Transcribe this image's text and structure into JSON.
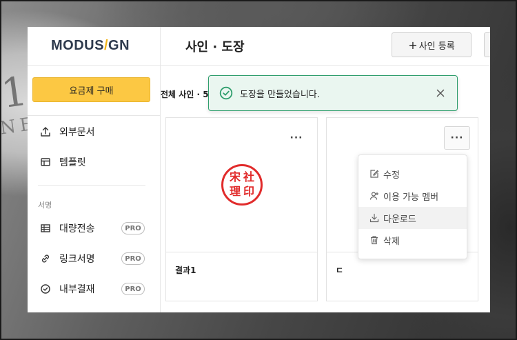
{
  "brand": {
    "logo_left": "MODUS",
    "logo_slash": "/",
    "logo_right": "GN"
  },
  "sidebar": {
    "plan_button": "요금제 구매",
    "items_top": [
      {
        "label": "외부문서",
        "icon": "upload-icon"
      },
      {
        "label": "템플릿",
        "icon": "template-icon"
      }
    ],
    "section_label": "서명",
    "items_sign": [
      {
        "label": "대량전송",
        "icon": "table-icon",
        "badge": "PRO"
      },
      {
        "label": "링크서명",
        "icon": "link-icon",
        "badge": "PRO"
      },
      {
        "label": "내부결재",
        "icon": "check-circle-icon",
        "badge": "PRO"
      }
    ]
  },
  "header": {
    "title": "사인 · 도장",
    "register_button": "사인 등록",
    "register_button_symbol": "+"
  },
  "main": {
    "filter_label": "전체 사인 · 5",
    "cards": [
      {
        "name": "결과1",
        "stamp_chars": [
          "宋",
          "社",
          "理",
          "印"
        ]
      },
      {
        "name": "ㄷ"
      }
    ],
    "more_symbol": "···"
  },
  "menu": {
    "items": [
      {
        "label": "수정",
        "icon": "edit-icon"
      },
      {
        "label": "이용 가능 멤버",
        "icon": "add-member-icon"
      },
      {
        "label": "다운로드",
        "icon": "download-icon"
      },
      {
        "label": "삭제",
        "icon": "trash-icon"
      }
    ]
  },
  "toast": {
    "message": "도장을 만들었습니다.",
    "icon": "check-circle-icon",
    "close_icon": "close-icon"
  },
  "colors": {
    "accent": "#fcc843",
    "success": "#2f9e6d",
    "stamp": "#e12b2b",
    "logo": "#2e3a4d"
  }
}
